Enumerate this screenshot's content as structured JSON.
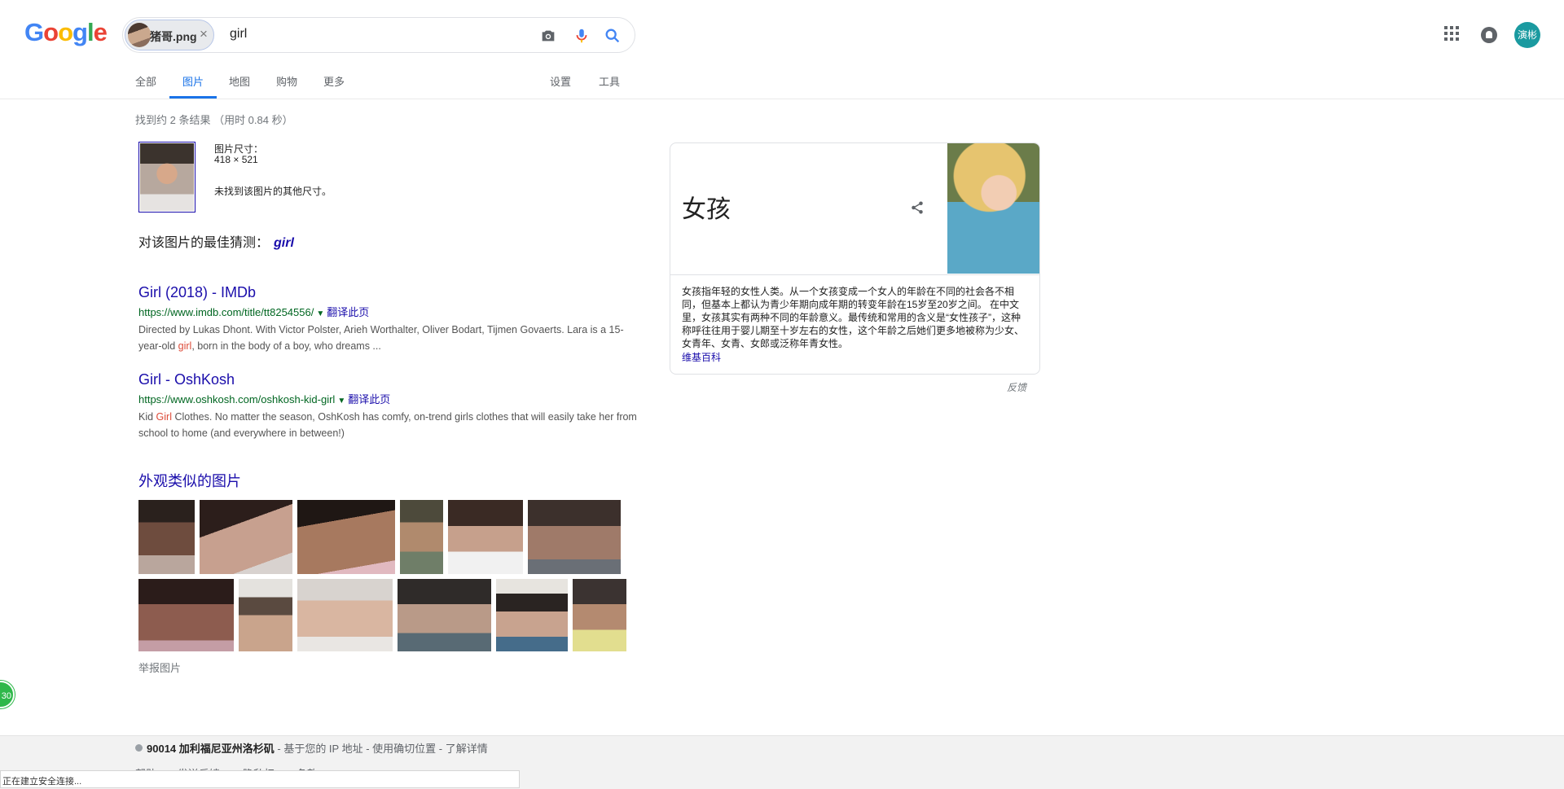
{
  "header": {
    "logo": "Google",
    "search": {
      "chip_label": "猪哥.png",
      "chip_close": "×",
      "query": "girl"
    },
    "avatar_text": "演彬"
  },
  "tabs": {
    "all": "全部",
    "images": "图片",
    "maps": "地图",
    "shopping": "购物",
    "more": "更多",
    "settings": "设置",
    "tools": "工具",
    "active": "images"
  },
  "result_stats": "找到约 2 条结果 （用时 0.84 秒）",
  "query_image": {
    "size_label": "图片尺寸：",
    "size_value": "418 × 521",
    "no_other_sizes": "未找到该图片的其他尺寸。"
  },
  "best_guess": {
    "label": "对该图片的最佳猜测：",
    "value": "girl"
  },
  "results": [
    {
      "title": "Girl (2018) - IMDb",
      "url": "https://www.imdb.com/title/tt8254556/",
      "translate": "翻译此页",
      "snippet_1": "Directed by Lukas Dhont. With Victor Polster, Arieh Worthalter, Oliver Bodart, Tijmen Govaerts. Lara is a 15-year-old ",
      "snippet_hl": "girl",
      "snippet_2": ", born in the body of a boy, who dreams ..."
    },
    {
      "title": "Girl - OshKosh",
      "url": "https://www.oshkosh.com/oshkosh-kid-girl",
      "translate": "翻译此页",
      "snippet_1": "Kid ",
      "snippet_hl": "Girl",
      "snippet_2": " Clothes. No matter the season, OshKosh has comfy, on-trend girls clothes that will easily take her from school to home (and everywhere in between!)"
    }
  ],
  "similar_images": {
    "title": "外观类似的图片",
    "report": "举报图片"
  },
  "knowledge_panel": {
    "title": "女孩",
    "description": "女孩指年轻的女性人类。从一个女孩变成一个女人的年龄在不同的社会各不相同，但基本上都认为青少年期向成年期的转变年龄在15岁至20岁之间。 在中文里，女孩其实有两种不同的年龄意义。最传统和常用的含义是“女性孩子”，这种称呼往往用于婴儿期至十岁左右的女性，这个年龄之后她们更多地被称为少女、女青年、女青、女郎或泛称年青女性。",
    "source": "维基百科",
    "feedback": "反馈"
  },
  "footer": {
    "location_bold": "90014 加利福尼亚州洛杉矶",
    "location_rest": " - 基于您的 IP 地址 - 使用确切位置 - 了解详情",
    "links": [
      "帮助",
      "发送反馈",
      "隐私权",
      "条款"
    ]
  },
  "status_bar": "正在建立安全连接...",
  "float_badge": "30",
  "colors": {
    "link": "#1a0dab",
    "url_green": "#006621",
    "accent": "#1a73e8",
    "highlight": "#dd4b39"
  }
}
